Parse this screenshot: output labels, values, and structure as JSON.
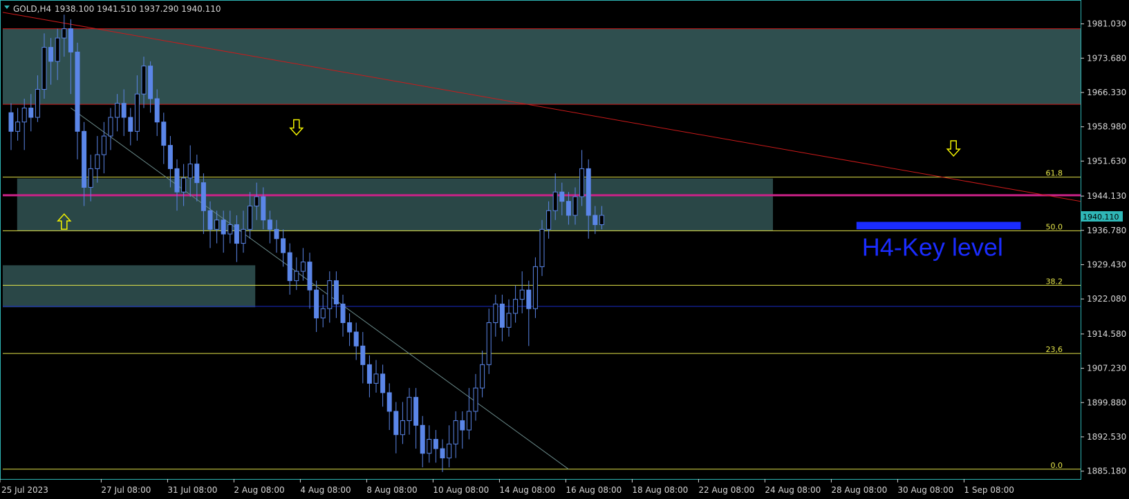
{
  "header": {
    "symbol": "GOLD,H4",
    "ohlc": "1938.100 1941.510 1937.290 1940.110"
  },
  "colors": {
    "background": "#000000",
    "frame": "#2fb7b7",
    "candle": "#5b86e8",
    "zone_fill": "#2f4f4f",
    "zone_border": "#cc1a1a",
    "trendline": "#cc1a1a",
    "fib_line": "#e6e64a",
    "key_level": "#cc2288",
    "key_text": "#1a2cff",
    "arrow": "#f2f200",
    "price_tag": "#2fb7b7"
  },
  "chart_data": {
    "type": "candlestick",
    "symbol": "GOLD",
    "timeframe": "H4",
    "ylim": [
      1883.5,
      1986.0
    ],
    "y_ticks": [
      "1981.030",
      "1973.680",
      "1966.330",
      "1958.980",
      "1951.630",
      "1944.130",
      "1936.780",
      "1929.430",
      "1922.080",
      "1914.580",
      "1907.230",
      "1899.880",
      "1892.530",
      "1885.180"
    ],
    "x_ticks": [
      {
        "label": "25 Jul 2023",
        "i": 0
      },
      {
        "label": "27 Jul 08:00",
        "i": 14
      },
      {
        "label": "31 Jul 08:00",
        "i": 24
      },
      {
        "label": "2 Aug 08:00",
        "i": 34
      },
      {
        "label": "4 Aug 08:00",
        "i": 44
      },
      {
        "label": "8 Aug 08:00",
        "i": 54
      },
      {
        "label": "10 Aug 08:00",
        "i": 64
      },
      {
        "label": "14 Aug 08:00",
        "i": 74
      },
      {
        "label": "16 Aug 08:00",
        "i": 84
      },
      {
        "label": "18 Aug 08:00",
        "i": 94
      },
      {
        "label": "22 Aug 08:00",
        "i": 104
      },
      {
        "label": "24 Aug 08:00",
        "i": 114
      },
      {
        "label": "28 Aug 08:00",
        "i": 124
      },
      {
        "label": "30 Aug 08:00",
        "i": 134
      },
      {
        "label": "1 Sep 08:00",
        "i": 144
      }
    ],
    "current_price": "1940.110",
    "candles": [
      [
        1962,
        1958,
        1964,
        1954
      ],
      [
        1958,
        1960,
        1963,
        1956
      ],
      [
        1960,
        1963,
        1965,
        1954
      ],
      [
        1963,
        1961,
        1966,
        1958
      ],
      [
        1961,
        1967,
        1970,
        1960
      ],
      [
        1967,
        1976,
        1979,
        1965
      ],
      [
        1976,
        1973,
        1978,
        1968
      ],
      [
        1973,
        1978,
        1980,
        1969
      ],
      [
        1978,
        1980,
        1983,
        1974
      ],
      [
        1980,
        1975,
        1982,
        1966
      ],
      [
        1975,
        1958,
        1977,
        1952
      ],
      [
        1958,
        1946,
        1960,
        1942
      ],
      [
        1946,
        1950,
        1953,
        1943
      ],
      [
        1950,
        1953,
        1957,
        1947
      ],
      [
        1953,
        1957,
        1960,
        1949
      ],
      [
        1957,
        1961,
        1963,
        1954
      ],
      [
        1961,
        1964,
        1966,
        1958
      ],
      [
        1964,
        1961,
        1967,
        1957
      ],
      [
        1961,
        1958,
        1963,
        1955
      ],
      [
        1958,
        1966,
        1970,
        1956
      ],
      [
        1966,
        1972,
        1974,
        1963
      ],
      [
        1972,
        1965,
        1973,
        1962
      ],
      [
        1965,
        1960,
        1967,
        1957
      ],
      [
        1960,
        1955,
        1962,
        1951
      ],
      [
        1955,
        1950,
        1957,
        1946
      ],
      [
        1950,
        1945,
        1952,
        1941
      ],
      [
        1945,
        1948,
        1951,
        1942
      ],
      [
        1948,
        1951,
        1955,
        1944
      ],
      [
        1951,
        1947,
        1953,
        1943
      ],
      [
        1947,
        1941,
        1949,
        1936
      ],
      [
        1941,
        1937,
        1943,
        1933
      ],
      [
        1937,
        1939,
        1941,
        1934
      ],
      [
        1939,
        1936,
        1941,
        1932
      ],
      [
        1936,
        1938,
        1941,
        1934
      ],
      [
        1938,
        1934,
        1940,
        1930
      ],
      [
        1934,
        1937,
        1941,
        1932
      ],
      [
        1937,
        1942,
        1945,
        1935
      ],
      [
        1942,
        1944,
        1947,
        1939
      ],
      [
        1944,
        1939,
        1946,
        1937
      ],
      [
        1939,
        1937,
        1941,
        1934
      ],
      [
        1937,
        1935,
        1939,
        1932
      ],
      [
        1935,
        1932,
        1937,
        1929
      ],
      [
        1932,
        1926,
        1934,
        1923
      ],
      [
        1926,
        1928,
        1931,
        1924
      ],
      [
        1928,
        1930,
        1933,
        1926
      ],
      [
        1930,
        1924,
        1932,
        1920
      ],
      [
        1924,
        1918,
        1926,
        1915
      ],
      [
        1918,
        1920,
        1923,
        1916
      ],
      [
        1920,
        1926,
        1928,
        1917
      ],
      [
        1926,
        1921,
        1928,
        1918
      ],
      [
        1921,
        1917,
        1923,
        1914
      ],
      [
        1917,
        1915,
        1919,
        1912
      ],
      [
        1915,
        1912,
        1917,
        1909
      ],
      [
        1912,
        1908,
        1915,
        1904
      ],
      [
        1908,
        1904,
        1910,
        1901
      ],
      [
        1904,
        1906,
        1909,
        1902
      ],
      [
        1906,
        1902,
        1908,
        1899
      ],
      [
        1902,
        1898,
        1904,
        1894
      ],
      [
        1898,
        1893,
        1900,
        1889
      ],
      [
        1893,
        1896,
        1900,
        1891
      ],
      [
        1896,
        1901,
        1903,
        1893
      ],
      [
        1901,
        1895,
        1903,
        1890
      ],
      [
        1895,
        1889,
        1897,
        1886
      ],
      [
        1889,
        1892,
        1895,
        1887
      ],
      [
        1892,
        1890,
        1894,
        1887
      ],
      [
        1890,
        1888,
        1892,
        1885
      ],
      [
        1888,
        1891,
        1895,
        1886
      ],
      [
        1891,
        1896,
        1898,
        1888
      ],
      [
        1896,
        1894,
        1898,
        1890
      ],
      [
        1894,
        1898,
        1903,
        1892
      ],
      [
        1898,
        1903,
        1906,
        1896
      ],
      [
        1903,
        1908,
        1911,
        1901
      ],
      [
        1908,
        1917,
        1920,
        1906
      ],
      [
        1917,
        1921,
        1923,
        1914
      ],
      [
        1921,
        1916,
        1923,
        1913
      ],
      [
        1916,
        1919,
        1922,
        1914
      ],
      [
        1919,
        1922,
        1925,
        1917
      ],
      [
        1922,
        1924,
        1928,
        1919
      ],
      [
        1924,
        1920,
        1926,
        1912
      ],
      [
        1920,
        1929,
        1931,
        1918
      ],
      [
        1929,
        1937,
        1939,
        1927
      ],
      [
        1937,
        1941,
        1943,
        1935
      ],
      [
        1941,
        1945,
        1949,
        1939
      ],
      [
        1945,
        1943,
        1947,
        1940
      ],
      [
        1943,
        1940,
        1945,
        1938
      ],
      [
        1940,
        1944,
        1946,
        1938
      ],
      [
        1944,
        1950,
        1954,
        1942
      ],
      [
        1950,
        1940,
        1952,
        1935
      ],
      [
        1940,
        1938,
        1942,
        1936
      ],
      [
        1938,
        1940,
        1942,
        1937
      ]
    ],
    "zones": [
      {
        "top": 1980.0,
        "bottom": 1963.8,
        "from_i": 0,
        "to_i": "end"
      },
      {
        "top": 1947.9,
        "bottom": 1936.7,
        "from_i": 3,
        "to_i": 115
      },
      {
        "top": 1929.3,
        "bottom": 1920.3,
        "from_i": 0,
        "to_i": 37
      }
    ],
    "fib_levels": [
      {
        "label": "61.8",
        "price": 1948.2
      },
      {
        "label": "50.0",
        "price": 1936.7
      },
      {
        "label": "38.2",
        "price": 1925.0
      },
      {
        "label": "23,6",
        "price": 1910.4
      },
      {
        "label": "0.0",
        "price": 1885.6
      }
    ],
    "key_level": {
      "price": 1944.3,
      "label": "H4-Key level"
    },
    "blue_line": {
      "price": 1920.5
    },
    "support_box": {
      "price_top": 1938.6,
      "price_bottom": 1937.0,
      "from_i": 128,
      "to_i": 149
    },
    "trendline": {
      "from": {
        "i": 0,
        "price": 1983.5
      },
      "to": {
        "i": "end",
        "price": 1943.0
      }
    },
    "thin_line": {
      "from": {
        "i": 9,
        "price": 1963.0
      },
      "to": {
        "i": 84,
        "price": 1885.6
      }
    },
    "arrows": [
      {
        "dir": "up",
        "i": 8,
        "price": 1938.5
      },
      {
        "dir": "down",
        "i": 43,
        "price": 1959.0
      },
      {
        "dir": "down",
        "i": 142,
        "price": 1954.5
      }
    ]
  }
}
